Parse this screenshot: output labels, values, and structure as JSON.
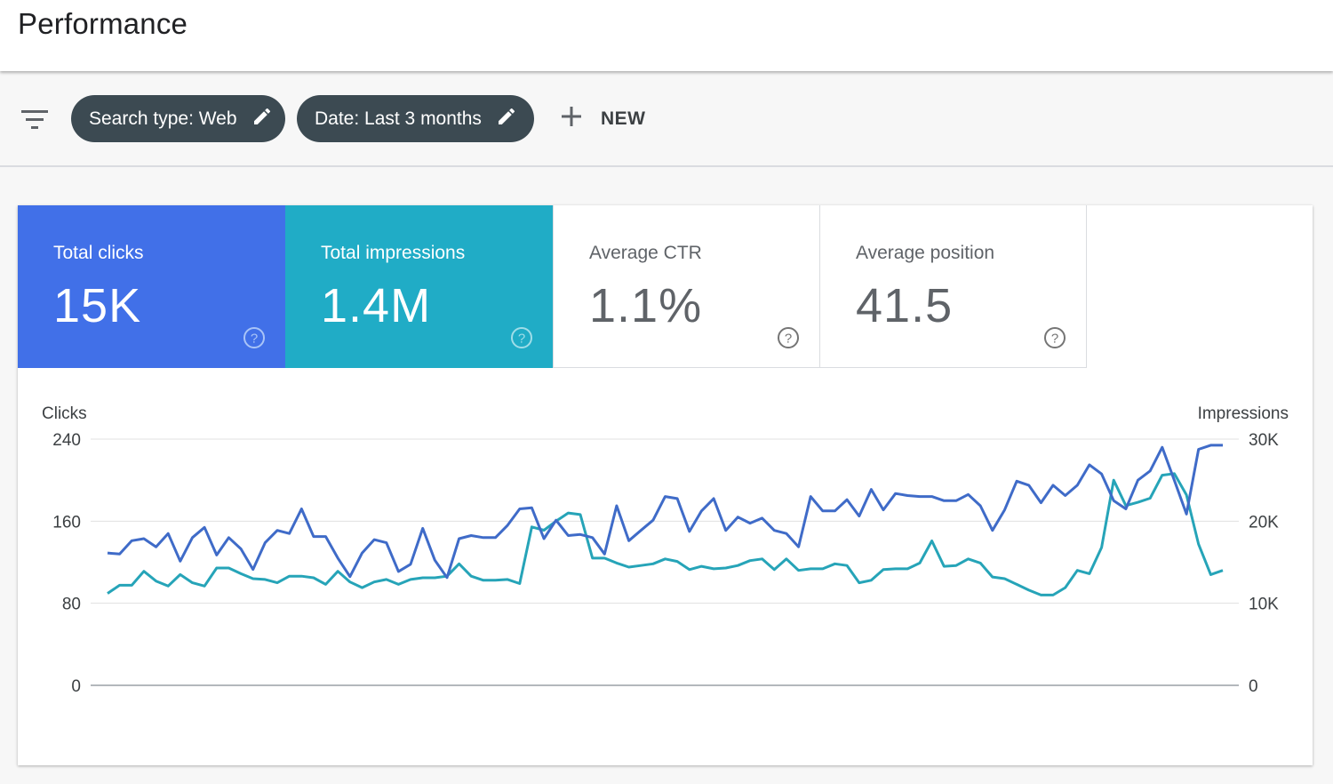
{
  "header": {
    "title": "Performance"
  },
  "filters": {
    "search_type": "Search type: Web",
    "date": "Date: Last 3 months",
    "new_label": "NEW"
  },
  "metrics": {
    "clicks": {
      "label": "Total clicks",
      "value": "15K"
    },
    "impressions": {
      "label": "Total impressions",
      "value": "1.4M"
    },
    "ctr": {
      "label": "Average CTR",
      "value": "1.1%"
    },
    "position": {
      "label": "Average position",
      "value": "41.5"
    }
  },
  "colors": {
    "clicks": "#4170e8",
    "impressions": "#20acc6",
    "clicks_line": "#3f6bc8",
    "impressions_line": "#26a4b8",
    "chip": "#3c4a52"
  },
  "icons": [
    "filter-icon",
    "edit-icon",
    "plus-icon",
    "help-icon"
  ],
  "chart_data": {
    "type": "line",
    "ylabel": "Clicks",
    "y2label": "Impressions",
    "ylim": [
      0,
      240
    ],
    "y2lim": [
      0,
      30000
    ],
    "yticks": [
      "240",
      "160",
      "80",
      "0"
    ],
    "y2ticks": [
      "30K",
      "20K",
      "10K",
      "0"
    ],
    "grid": true,
    "series": [
      {
        "axis": "left",
        "values": [
          129,
          128,
          141,
          143,
          135,
          148,
          121,
          144,
          154,
          127,
          144,
          133,
          113,
          139,
          151,
          148,
          172,
          145,
          145,
          124,
          106,
          129,
          142,
          139,
          111,
          118,
          153,
          122,
          105,
          143,
          146,
          144,
          144,
          156,
          172,
          173,
          143,
          161,
          146,
          147,
          144,
          128,
          175,
          141,
          151,
          161,
          184,
          182,
          150,
          170,
          182,
          151,
          164,
          158,
          163,
          151,
          148,
          135,
          184,
          170,
          170,
          181,
          165,
          191,
          171,
          187,
          185,
          184,
          184,
          180,
          180,
          186,
          175,
          151,
          171,
          199,
          195,
          178,
          195,
          185,
          195,
          215,
          206,
          180,
          172,
          200,
          209,
          232,
          200,
          167,
          230,
          234,
          234
        ]
      },
      {
        "axis": "right",
        "values": [
          11200,
          12200,
          12200,
          13900,
          12700,
          12100,
          13500,
          12500,
          12100,
          14300,
          14300,
          13600,
          13000,
          12900,
          12500,
          13300,
          13300,
          13100,
          12300,
          13900,
          12600,
          11900,
          12600,
          12900,
          12300,
          12900,
          13100,
          13100,
          13300,
          14800,
          13300,
          12800,
          12800,
          12900,
          12400,
          19300,
          18900,
          20000,
          21000,
          20800,
          15500,
          15500,
          14900,
          14400,
          14600,
          14800,
          15400,
          15100,
          14100,
          14500,
          14200,
          14300,
          14600,
          15200,
          15400,
          14100,
          15400,
          14000,
          14200,
          14200,
          14800,
          14600,
          12500,
          12800,
          14100,
          14200,
          14200,
          14900,
          17600,
          14500,
          14600,
          15400,
          14900,
          13200,
          13000,
          12300,
          11600,
          11000,
          11000,
          11900,
          14000,
          13600,
          16800,
          25000,
          21900,
          22300,
          22800,
          25600,
          25800,
          23200,
          17200,
          13500,
          14000
        ]
      }
    ]
  }
}
